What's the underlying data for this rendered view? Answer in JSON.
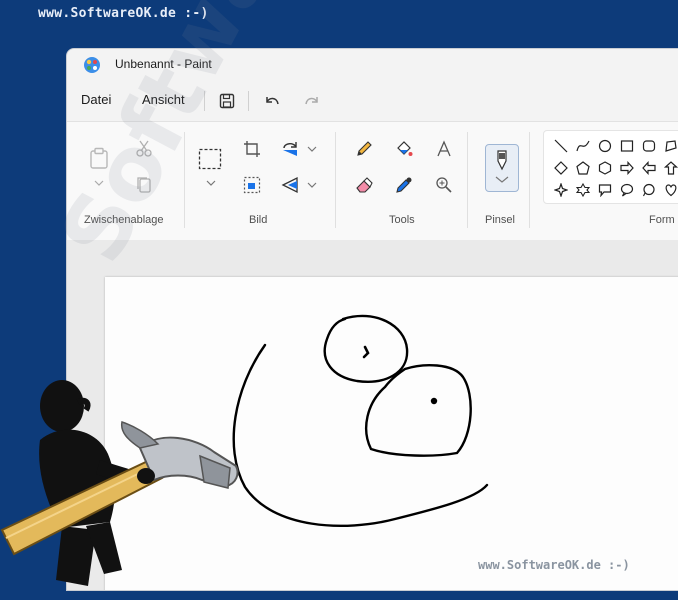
{
  "credits": {
    "top": "www.SoftwareOK.de :-)",
    "bottom": "www.SoftwareOK.de :-)",
    "watermark": "SoftwareOK.de"
  },
  "window": {
    "title": "Unbenannt - Paint"
  },
  "menu": {
    "file": "Datei",
    "view": "Ansicht"
  },
  "ribbon": {
    "groups": {
      "clipboard": "Zwischenablage",
      "image": "Bild",
      "tools": "Tools",
      "brushes": "Pinsel",
      "shapes": "Form"
    }
  },
  "colors": {
    "background": "#0d3b7a",
    "accent": "#1a73e8"
  }
}
